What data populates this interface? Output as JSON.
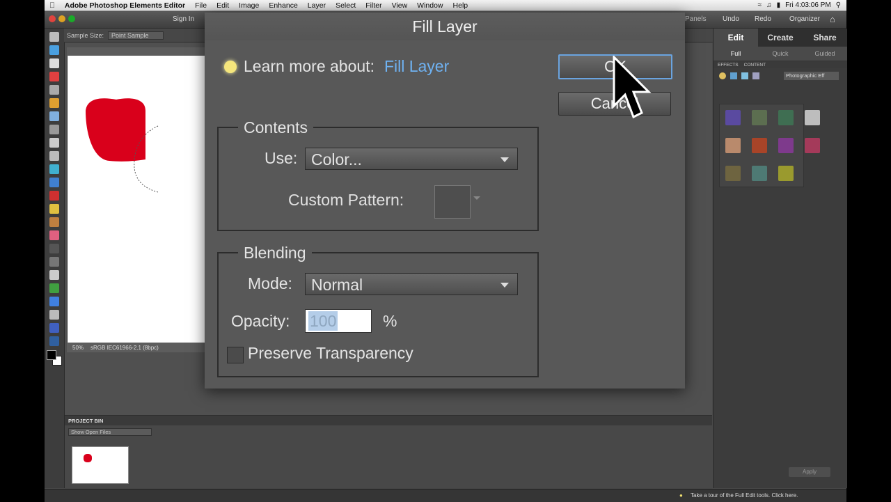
{
  "menubar": {
    "app_name": "Adobe Photoshop Elements Editor",
    "items": [
      "File",
      "Edit",
      "Image",
      "Enhance",
      "Layer",
      "Select",
      "Filter",
      "View",
      "Window",
      "Help"
    ],
    "clock": "Fri 4:03:06 PM"
  },
  "topbar": {
    "sign_in": "Sign In",
    "panels": "Panels",
    "undo": "Undo",
    "redo": "Redo",
    "organizer": "Organizer"
  },
  "options": {
    "sample_size_label": "Sample Size:",
    "sample_size_value": "Point Sample"
  },
  "document": {
    "zoom": "50%",
    "color_profile": "sRGB IEC61966-2.1 (8bpc)"
  },
  "project_bin": {
    "title": "PROJECT BIN",
    "show_value": "Show Open Files"
  },
  "panel": {
    "tabs": [
      "Edit",
      "Create",
      "Share"
    ],
    "subtabs": [
      "Full",
      "Quick",
      "Guided"
    ],
    "effects_label": "EFFECTS",
    "content_label": "CONTENT",
    "filter_value": "Photographic Eff",
    "apply_label": "Apply",
    "swatch_colors": [
      "#5a4aa0",
      "#5c6e50",
      "#3f6e52",
      "#bdbdbd",
      "#b98a6c",
      "#a84428",
      "#7e3a8c",
      "#a43a5a",
      "#6e6440",
      "#4e7a74",
      "#9a9a2e"
    ]
  },
  "status": {
    "hint": "Take a tour of the Full Edit tools. Click here."
  },
  "dialog": {
    "title": "Fill Layer",
    "learn_more_label": "Learn more about:",
    "learn_more_link": "Fill Layer",
    "ok_label": "OK",
    "cancel_label": "Cancel",
    "contents_label": "Contents",
    "use_label": "Use:",
    "use_value": "Color...",
    "custom_pattern_label": "Custom Pattern:",
    "blending_label": "Blending",
    "mode_label": "Mode:",
    "mode_value": "Normal",
    "opacity_label": "Opacity:",
    "opacity_value": "100",
    "opacity_unit": "%",
    "preserve_label": "Preserve Transparency",
    "preserve_checked": false
  }
}
